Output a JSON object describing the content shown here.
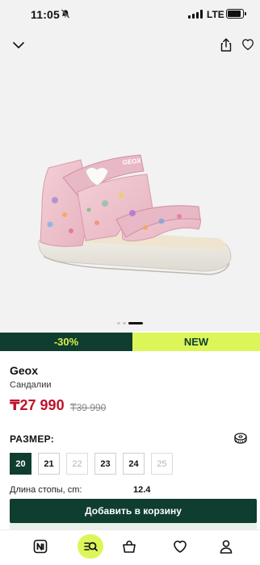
{
  "status_bar": {
    "time": "11:05",
    "network": "LTE",
    "battery_level": 0.9,
    "icons": [
      "bell-off-icon",
      "signal-icon",
      "battery-icon"
    ]
  },
  "top_nav": {
    "icons": [
      "chevron-down-icon",
      "share-icon",
      "heart-icon"
    ]
  },
  "gallery": {
    "image_description_icon": "sandal-image",
    "page_indicator": {
      "count": 3,
      "active": 2
    }
  },
  "badges": {
    "discount": "-30%",
    "new": "NEW"
  },
  "product": {
    "brand": "Geox",
    "type": "Сандалии",
    "price": "₸27 990",
    "old_price": "₸39 990",
    "image_logo_text": "GEOX"
  },
  "sizes": {
    "title": "РАЗМЕР:",
    "options": [
      {
        "label": "20",
        "state": "selected"
      },
      {
        "label": "21",
        "state": "available"
      },
      {
        "label": "22",
        "state": "disabled"
      },
      {
        "label": "23",
        "state": "available"
      },
      {
        "label": "24",
        "state": "available"
      },
      {
        "label": "25",
        "state": "disabled"
      }
    ]
  },
  "foot_length": {
    "label": "Длина стопы, cm:",
    "value": "12.4"
  },
  "cart": {
    "button_label": "Добавить в корзину"
  },
  "tabbar": {
    "icons": [
      "home-icon",
      "catalog-search-icon",
      "bag-icon",
      "heart-icon",
      "profile-icon"
    ],
    "active": "catalog-search-icon"
  },
  "colors": {
    "brand_green": "#0f3d2f",
    "accent_lime": "#dcf65a",
    "price_red": "#c0122e"
  }
}
